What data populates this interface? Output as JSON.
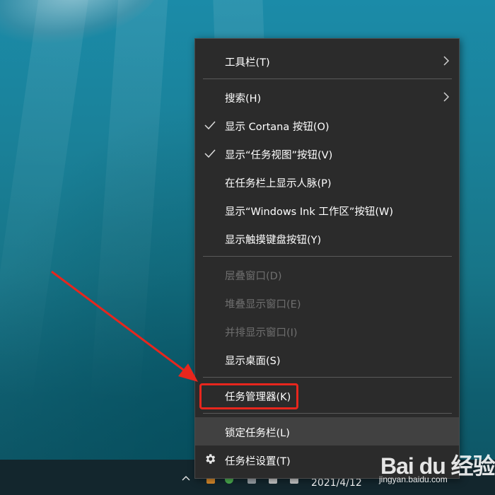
{
  "menu": {
    "items": [
      {
        "label": "工具栏(T)",
        "has_submenu": true
      },
      {
        "label": "搜索(H)",
        "has_submenu": true
      },
      {
        "label": "显示 Cortana 按钮(O)",
        "checked": true
      },
      {
        "label": "显示“任务视图”按钮(V)",
        "checked": true
      },
      {
        "label": "在任务栏上显示人脉(P)"
      },
      {
        "label": "显示“Windows Ink 工作区”按钮(W)"
      },
      {
        "label": "显示触摸键盘按钮(Y)"
      },
      {
        "label": "层叠窗口(D)",
        "disabled": true
      },
      {
        "label": "堆叠显示窗口(E)",
        "disabled": true
      },
      {
        "label": "并排显示窗口(I)",
        "disabled": true
      },
      {
        "label": "显示桌面(S)"
      },
      {
        "label": "任务管理器(K)",
        "annotated": true
      },
      {
        "label": "锁定任务栏(L)",
        "hovered": true
      },
      {
        "label": "任务栏设置(T)",
        "icon": "gear-icon"
      }
    ]
  },
  "taskbar": {
    "clock_date": "2021/4/12"
  },
  "watermark": {
    "logo": "Bai du 经验",
    "url": "jingyan.baidu.com"
  },
  "colors": {
    "menu_bg": "#2b2b2b",
    "highlight_bg": "#414141",
    "annotation_red": "#e8261d",
    "disabled_text": "#6f6f6f"
  }
}
